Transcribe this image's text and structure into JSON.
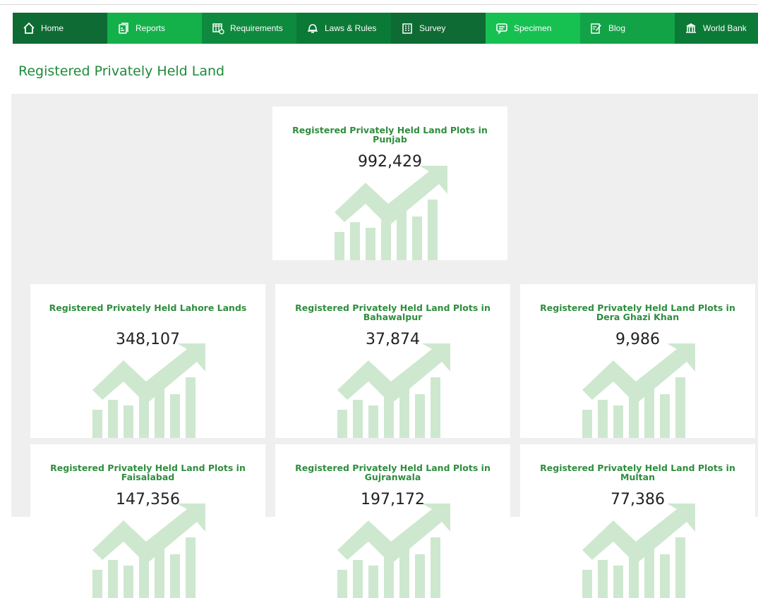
{
  "nav": {
    "items": [
      {
        "label": "Home",
        "icon": "home-icon",
        "color": "#0e6b33"
      },
      {
        "label": "Reports",
        "icon": "reports-icon",
        "color": "#14b04a"
      },
      {
        "label": "Requirements",
        "icon": "requirements-icon",
        "color": "#0e8a3e"
      },
      {
        "label": "Laws & Rules",
        "icon": "bell-icon",
        "color": "#0b7a36"
      },
      {
        "label": "Survey",
        "icon": "building-icon",
        "color": "#0e6b33"
      },
      {
        "label": "Specimen",
        "icon": "specimen-icon",
        "color": "#16c152"
      },
      {
        "label": "Blog",
        "icon": "blog-icon",
        "color": "#12a347"
      },
      {
        "label": "World Bank",
        "icon": "bank-icon",
        "color": "#0b7a36"
      }
    ]
  },
  "page": {
    "title": "Registered Privately Held Land"
  },
  "cards": [
    {
      "title": "Registered Privately Held Land Plots in Punjab",
      "value": "992,429"
    },
    {
      "title": "Registered Privately Held Lahore Lands",
      "value": "348,107"
    },
    {
      "title": "Registered Privately Held Land Plots in Bahawalpur",
      "value": "37,874"
    },
    {
      "title": "Registered Privately Held Land Plots in Dera Ghazi Khan",
      "value": "9,986"
    },
    {
      "title": "Registered Privately Held Land Plots in Faisalabad",
      "value": "147,356"
    },
    {
      "title": "Registered Privately Held Land Plots in Gujranwala",
      "value": "197,172"
    },
    {
      "title": "Registered Privately Held Land Plots in Multan",
      "value": "77,386"
    }
  ],
  "colors": {
    "accent_text": "#2f8d3e",
    "graphic": "#cde8cf",
    "panel": "#efefef"
  }
}
